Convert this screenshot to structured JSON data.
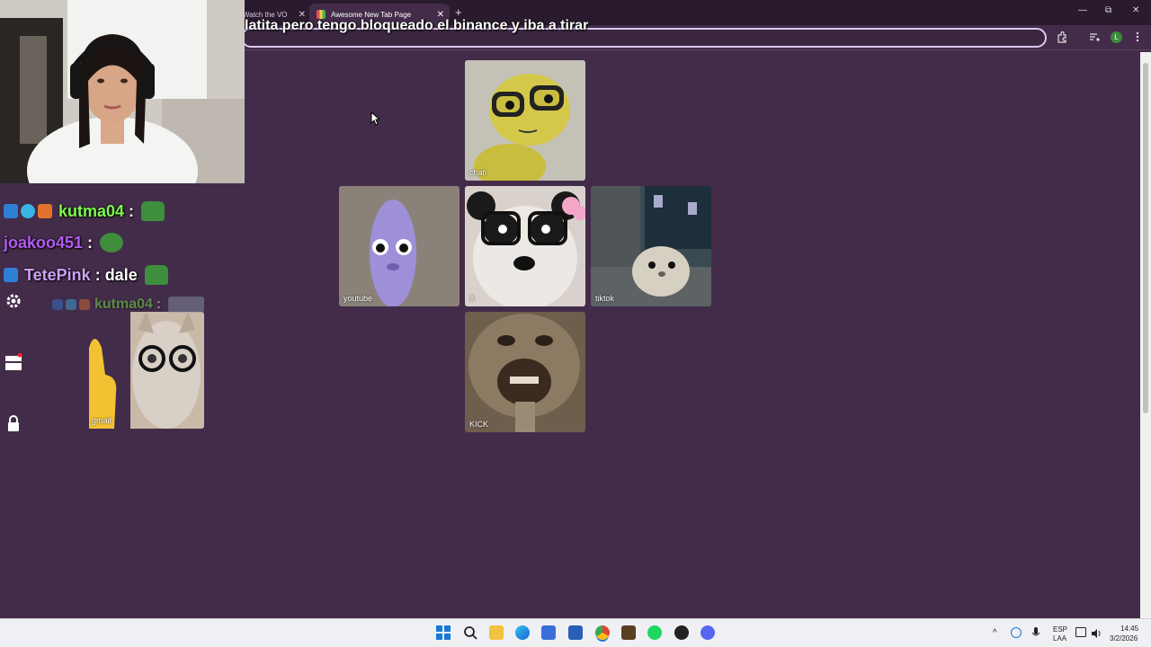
{
  "browser": {
    "tabs": [
      {
        "title": "Watch the VO",
        "close": "✕"
      },
      {
        "title": "Awesome New Tab Page",
        "close": "✕"
      }
    ],
    "new_tab": "+",
    "window_controls": {
      "minimize": "—",
      "maximize": "⧉",
      "close": "✕"
    },
    "profile_initial": "L"
  },
  "overlay_text": "latita pero tengo bloqueado el binance y iba a tirar",
  "tiles": [
    {
      "label": "chati",
      "icon": "yellow-character-glasses"
    },
    {
      "label": "youtube",
      "icon": "purple-blob-creature"
    },
    {
      "label": "X",
      "icon": "panda-glasses"
    },
    {
      "label": "tiktok",
      "icon": "hamster-minecraft"
    },
    {
      "label": "gmail",
      "icon": "cat-glasses-finger"
    },
    {
      "label": "KICK",
      "icon": "monkey-face"
    }
  ],
  "chat": [
    {
      "user": "kutma04",
      "sep": ":",
      "msg": "",
      "user_color": "#7cfc4a"
    },
    {
      "user": "joakoo451",
      "sep": ":",
      "msg": "",
      "user_color": "#b35cf0"
    },
    {
      "user": "TetePink",
      "sep": ":",
      "msg": "dale",
      "user_color": "#c9a2f5"
    },
    {
      "user": "kutma04",
      "sep": ":",
      "msg": "",
      "user_color": "#7cfc4a"
    }
  ],
  "taskbar": {
    "lang_top": "ESP",
    "lang_bottom": "LAA",
    "time": "14:45",
    "date": "3/2/2026"
  },
  "colors": {
    "page_bg": "#432c49",
    "titlebar": "#2a1a2e",
    "taskbar": "#eef0f4"
  }
}
